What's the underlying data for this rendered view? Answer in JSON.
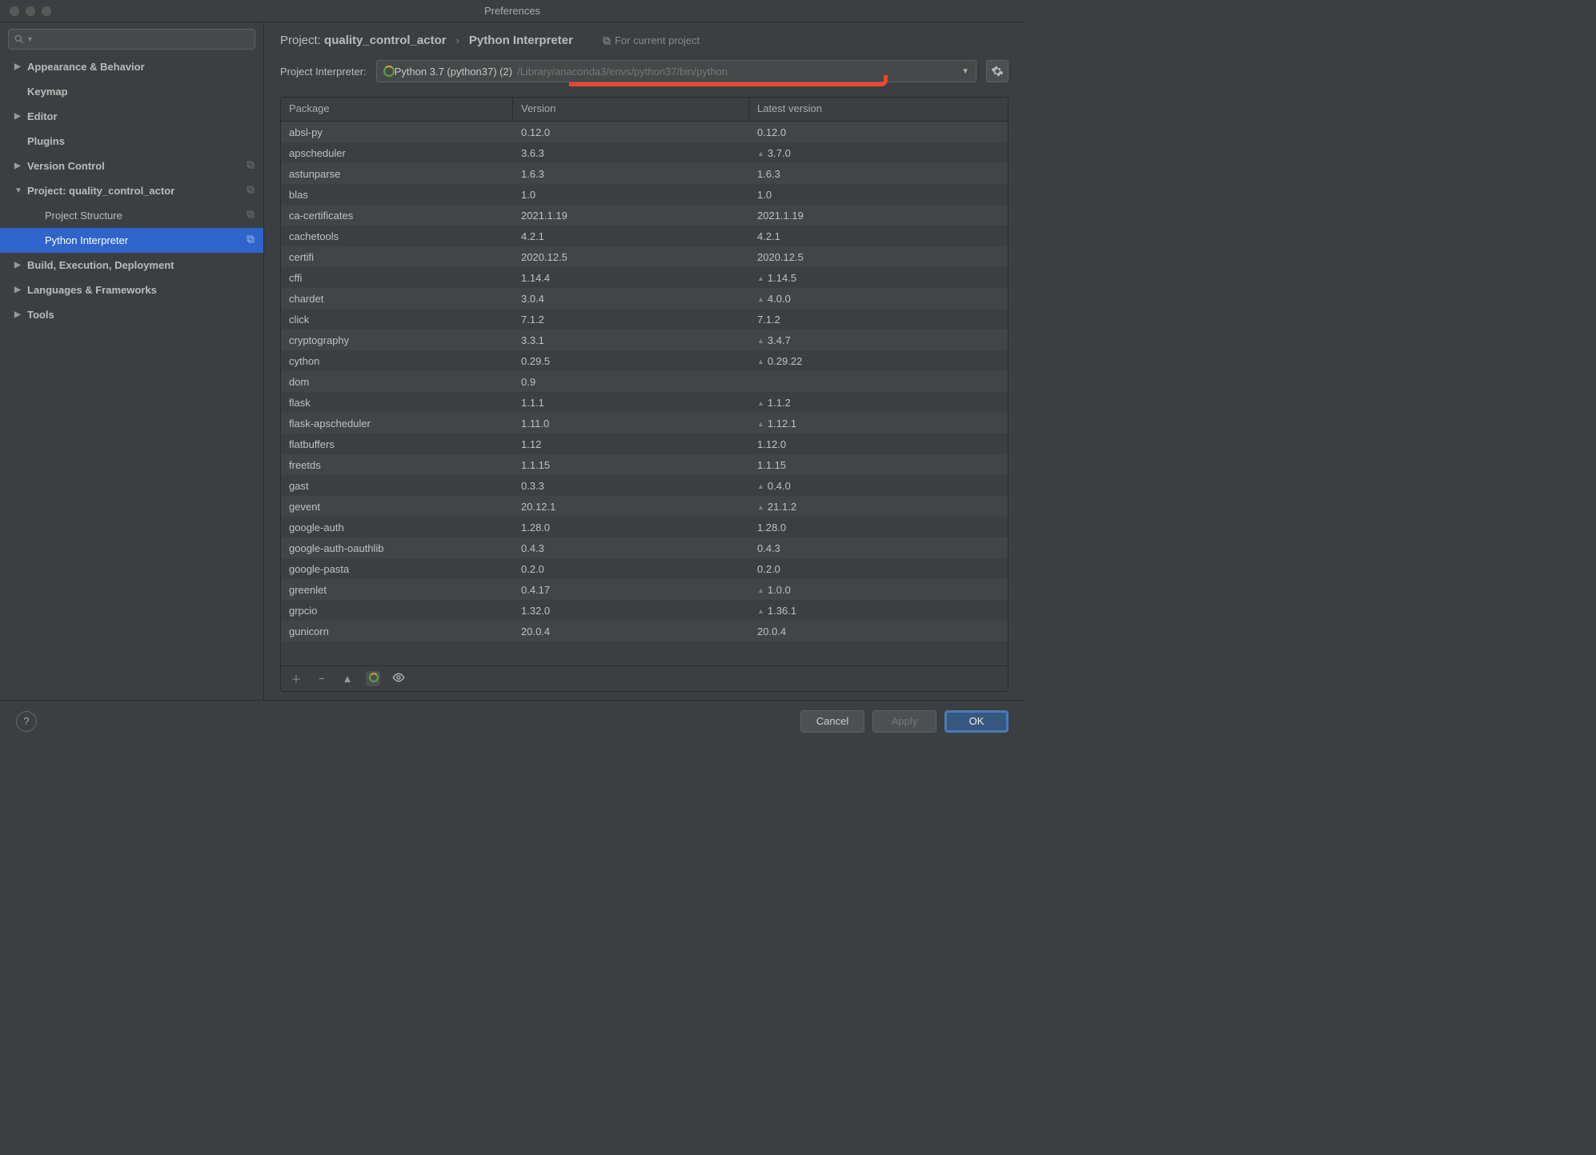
{
  "window": {
    "title": "Preferences"
  },
  "search": {
    "placeholder": ""
  },
  "sidebar": {
    "items": [
      {
        "label": "Appearance & Behavior",
        "expandable": true
      },
      {
        "label": "Keymap",
        "expandable": false
      },
      {
        "label": "Editor",
        "expandable": true
      },
      {
        "label": "Plugins",
        "expandable": false
      },
      {
        "label": "Version Control",
        "expandable": true,
        "copy": true
      },
      {
        "label": "Project: quality_control_actor",
        "expandable": true,
        "copy": true,
        "expanded": true,
        "children": [
          {
            "label": "Project Structure",
            "copy": true
          },
          {
            "label": "Python Interpreter",
            "copy": true,
            "selected": true
          }
        ]
      },
      {
        "label": "Build, Execution, Deployment",
        "expandable": true
      },
      {
        "label": "Languages & Frameworks",
        "expandable": true
      },
      {
        "label": "Tools",
        "expandable": true
      }
    ]
  },
  "breadcrumb": {
    "project_prefix": "Project:",
    "project_name": "quality_control_actor",
    "page": "Python Interpreter",
    "scope": "For current project"
  },
  "interpreter": {
    "label": "Project Interpreter:",
    "name": "Python 3.7 (python37) (2)",
    "path": "/Library/anaconda3/envs/python37/bin/python"
  },
  "table": {
    "headers": [
      "Package",
      "Version",
      "Latest version"
    ],
    "rows": [
      {
        "pkg": "absl-py",
        "ver": "0.12.0",
        "latest": "0.12.0",
        "up": false
      },
      {
        "pkg": "apscheduler",
        "ver": "3.6.3",
        "latest": "3.7.0",
        "up": true
      },
      {
        "pkg": "astunparse",
        "ver": "1.6.3",
        "latest": "1.6.3",
        "up": false
      },
      {
        "pkg": "blas",
        "ver": "1.0",
        "latest": "1.0",
        "up": false
      },
      {
        "pkg": "ca-certificates",
        "ver": "2021.1.19",
        "latest": "2021.1.19",
        "up": false
      },
      {
        "pkg": "cachetools",
        "ver": "4.2.1",
        "latest": "4.2.1",
        "up": false
      },
      {
        "pkg": "certifi",
        "ver": "2020.12.5",
        "latest": "2020.12.5",
        "up": false
      },
      {
        "pkg": "cffi",
        "ver": "1.14.4",
        "latest": "1.14.5",
        "up": true
      },
      {
        "pkg": "chardet",
        "ver": "3.0.4",
        "latest": "4.0.0",
        "up": true
      },
      {
        "pkg": "click",
        "ver": "7.1.2",
        "latest": "7.1.2",
        "up": false
      },
      {
        "pkg": "cryptography",
        "ver": "3.3.1",
        "latest": "3.4.7",
        "up": true
      },
      {
        "pkg": "cython",
        "ver": "0.29.5",
        "latest": "0.29.22",
        "up": true
      },
      {
        "pkg": "dom",
        "ver": "0.9",
        "latest": "",
        "up": false
      },
      {
        "pkg": "flask",
        "ver": "1.1.1",
        "latest": "1.1.2",
        "up": true
      },
      {
        "pkg": "flask-apscheduler",
        "ver": "1.11.0",
        "latest": "1.12.1",
        "up": true
      },
      {
        "pkg": "flatbuffers",
        "ver": "1.12",
        "latest": "1.12.0",
        "up": false
      },
      {
        "pkg": "freetds",
        "ver": "1.1.15",
        "latest": "1.1.15",
        "up": false
      },
      {
        "pkg": "gast",
        "ver": "0.3.3",
        "latest": "0.4.0",
        "up": true
      },
      {
        "pkg": "gevent",
        "ver": "20.12.1",
        "latest": "21.1.2",
        "up": true
      },
      {
        "pkg": "google-auth",
        "ver": "1.28.0",
        "latest": "1.28.0",
        "up": false
      },
      {
        "pkg": "google-auth-oauthlib",
        "ver": "0.4.3",
        "latest": "0.4.3",
        "up": false
      },
      {
        "pkg": "google-pasta",
        "ver": "0.2.0",
        "latest": "0.2.0",
        "up": false
      },
      {
        "pkg": "greenlet",
        "ver": "0.4.17",
        "latest": "1.0.0",
        "up": true
      },
      {
        "pkg": "grpcio",
        "ver": "1.32.0",
        "latest": "1.36.1",
        "up": true
      },
      {
        "pkg": "gunicorn",
        "ver": "20.0.4",
        "latest": "20.0.4",
        "up": false
      }
    ]
  },
  "footer": {
    "cancel": "Cancel",
    "apply": "Apply",
    "ok": "OK"
  }
}
